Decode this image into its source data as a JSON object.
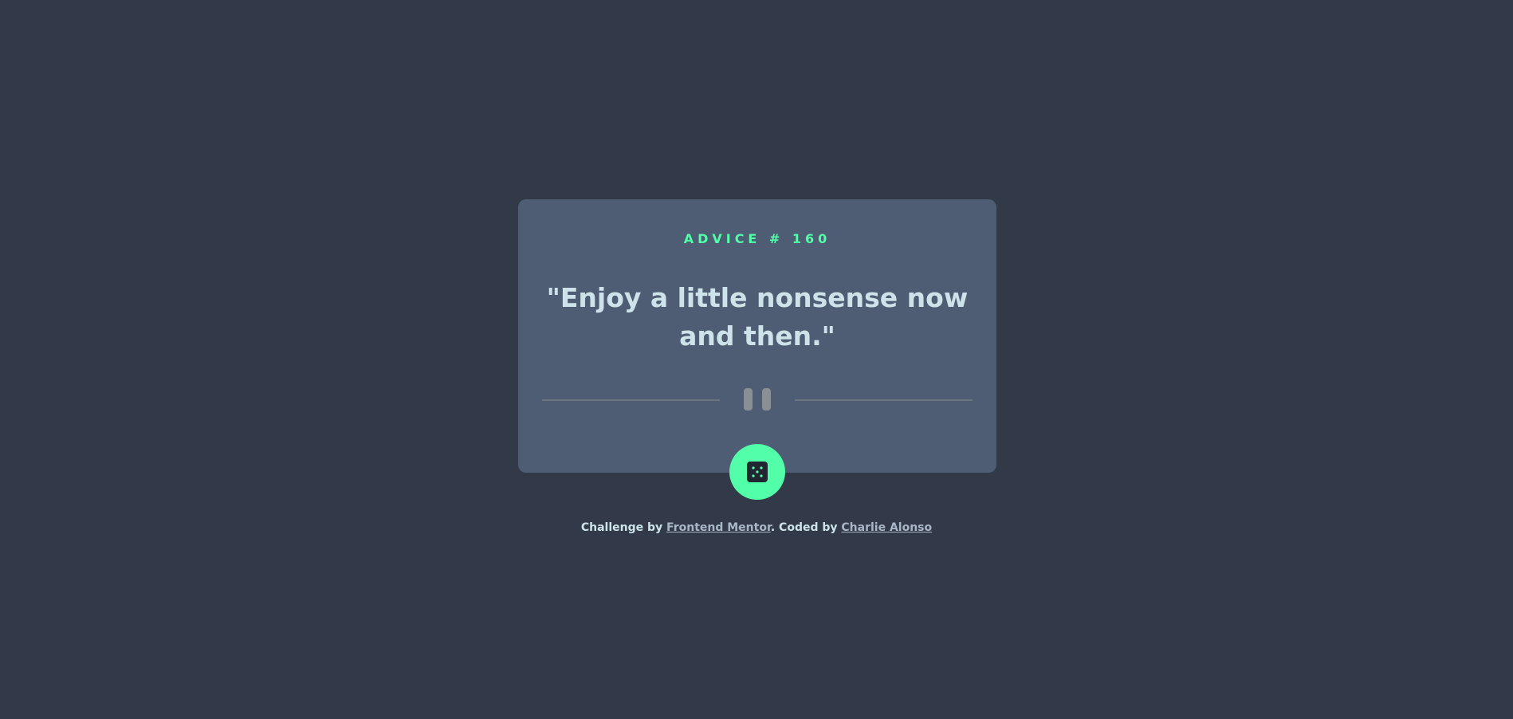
{
  "card": {
    "advice_label": "ADVICE # 160",
    "quote": "\"Enjoy a little nonsense now and then.\""
  },
  "divider": {
    "icon": "pause-icon"
  },
  "button": {
    "icon": "dice-icon"
  },
  "footer": {
    "prefix": "Challenge by",
    "challenge_link": "Frontend Mentor",
    "middle": ". Coded by",
    "author_link": "Charlie Alonso"
  },
  "colors": {
    "background": "#323a49",
    "card": "#4e5d73",
    "accent": "#52ffa8",
    "text": "#cee3e9"
  }
}
